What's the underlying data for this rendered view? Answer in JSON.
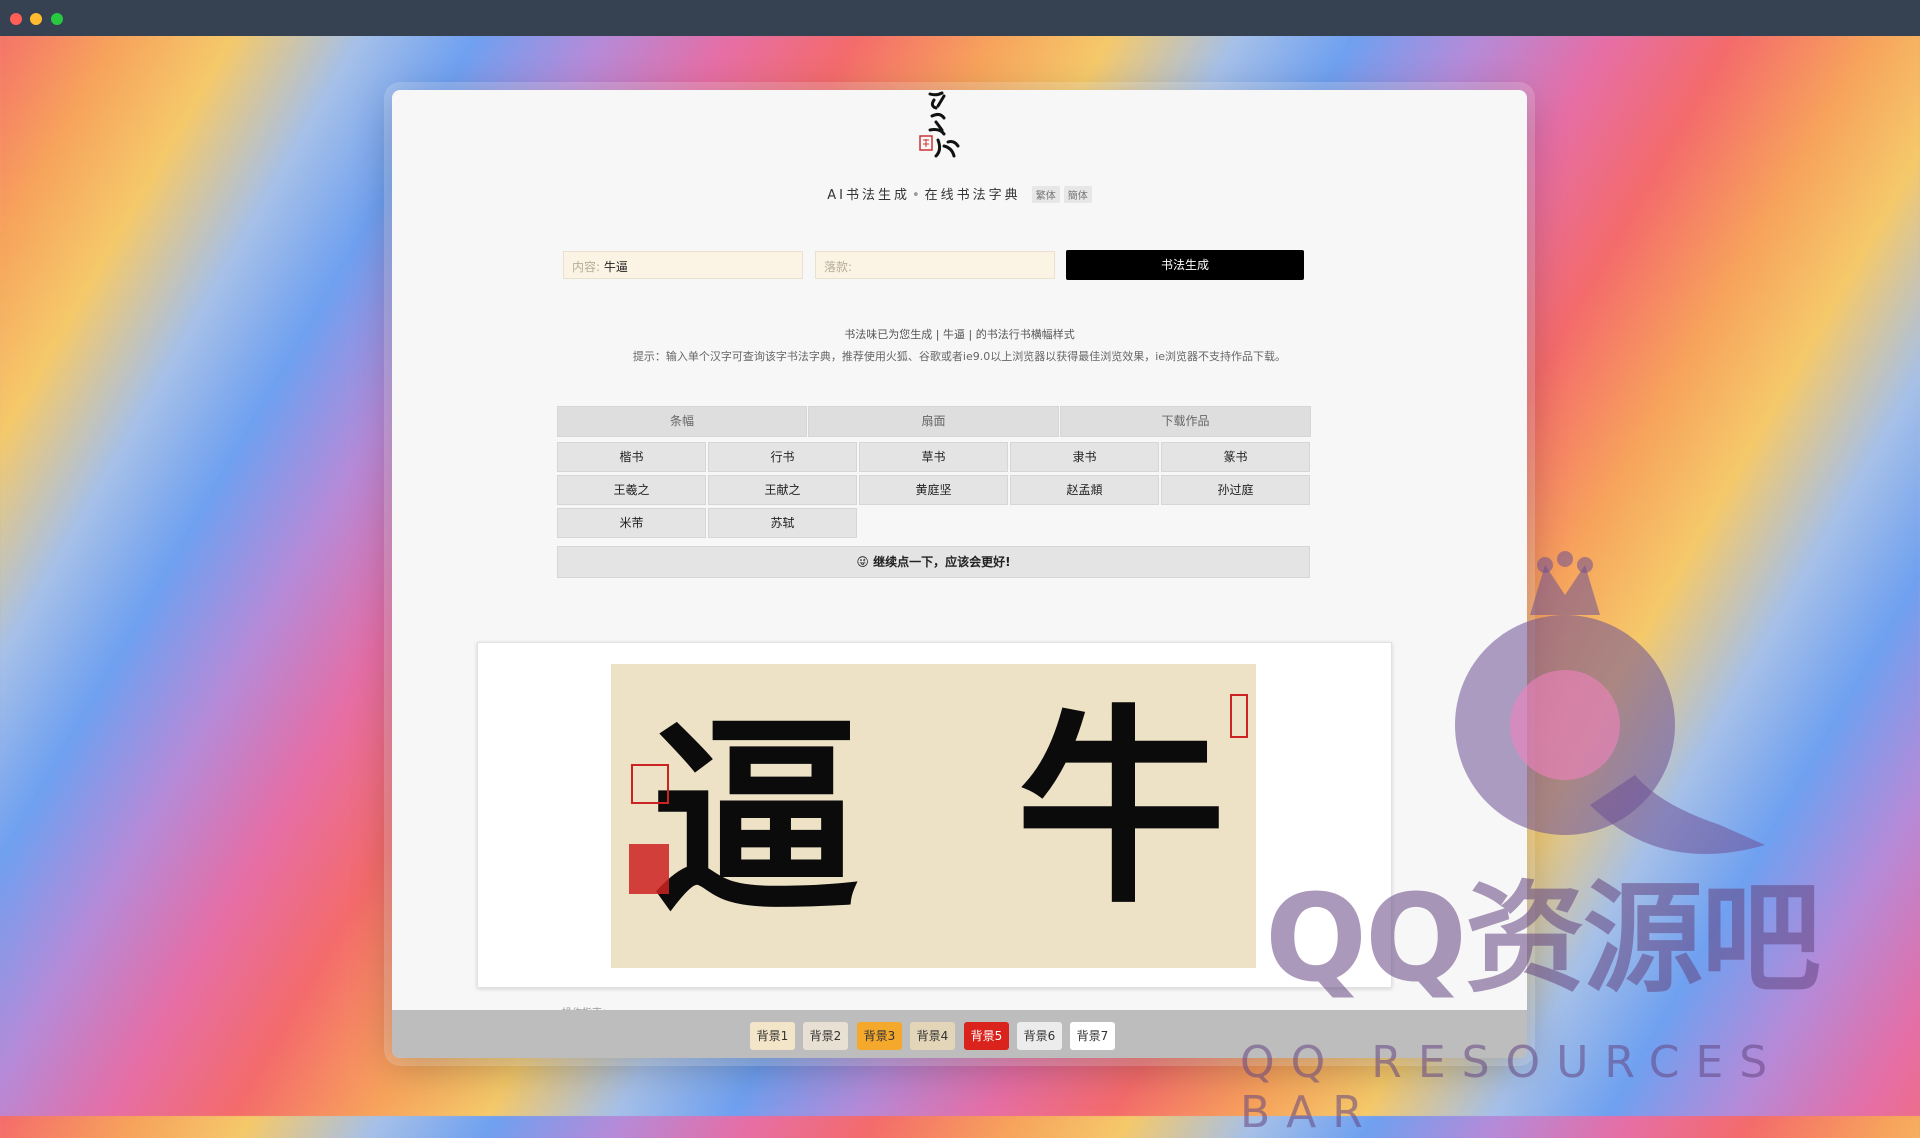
{
  "window_controls": {
    "close": "close",
    "minimize": "minimize",
    "zoom": "zoom"
  },
  "header": {
    "title_part1": "AI书法生成",
    "separator": "•",
    "title_part2": "在线书法字典",
    "tag_traditional": "繁体",
    "tag_simplified": "簡体"
  },
  "form": {
    "content_label": "内容:",
    "content_value": "牛逼",
    "signature_label": "落款:",
    "signature_value": "",
    "generate_label": "书法生成"
  },
  "notice": "书法味已为您生成 | 牛逼 | 的书法行书横幅样式",
  "tip": "提示：输入单个汉字可查询该字书法字典，推荐使用火狐、谷歌或者ie9.0以上浏览器以获得最佳浏览效果，ie浏览器不支持作品下载。",
  "format_tabs": [
    "条幅",
    "扇面",
    "下载作品"
  ],
  "style_buttons": [
    "楷书",
    "行书",
    "草书",
    "隶书",
    "篆书"
  ],
  "calligrapher_buttons": [
    "王羲之",
    "王献之",
    "黄庭坚",
    "赵孟頫",
    "孙过庭",
    "米芾",
    "苏轼"
  ],
  "more_button": "😜 继续点一下，应该会更好!",
  "artwork": {
    "char_right": "牛",
    "char_left": "逼"
  },
  "scroll_text": "操作指南：……",
  "backgrounds": [
    "背景1",
    "背景2",
    "背景3",
    "背景4",
    "背景5",
    "背景6",
    "背景7"
  ],
  "background_colors": [
    "#f3e6c8",
    "#e8e0d2",
    "#f4a82c",
    "#e3d5b8",
    "#d9231c",
    "#ececec",
    "#ffffff"
  ],
  "watermark": {
    "main": "QQ资源吧",
    "sub": "QQ RESOURCES BAR"
  }
}
